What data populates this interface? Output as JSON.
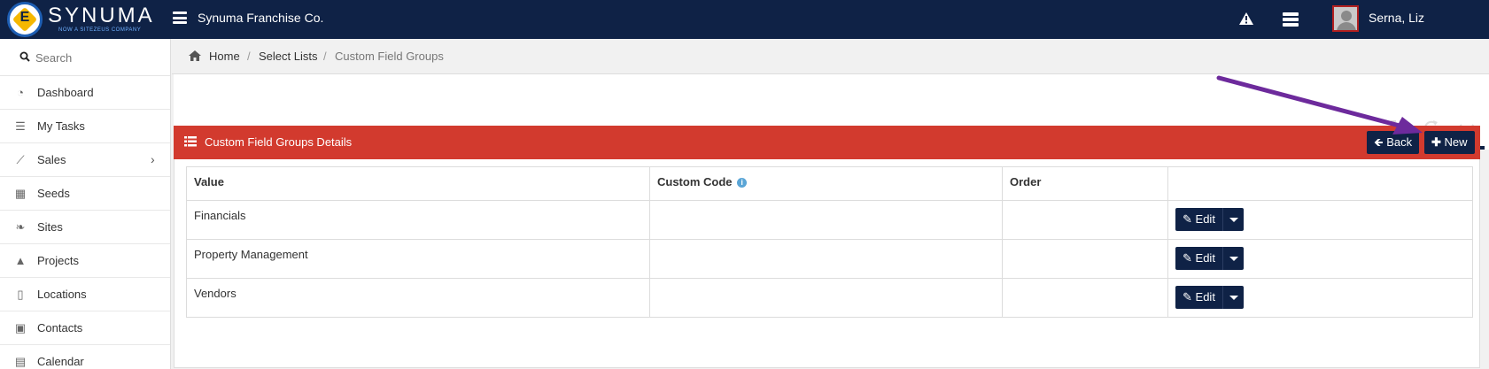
{
  "app": {
    "logo_text": "SYNUMA",
    "logo_subtext": "NOW A SITEZEUS COMPANY",
    "company": "Synuma Franchise Co.",
    "user_name": "Serna, Liz",
    "colors": {
      "topbar": "#0f2246",
      "panel_header": "#d23a2e",
      "button_dark": "#0f2246"
    }
  },
  "sidebar": {
    "search_placeholder": "Search",
    "items": [
      {
        "label": "Dashboard",
        "icon": "dashboard-icon"
      },
      {
        "label": "My Tasks",
        "icon": "list-icon"
      },
      {
        "label": "Sales",
        "icon": "chart-line-icon",
        "has_children": true
      },
      {
        "label": "Seeds",
        "icon": "grid-icon"
      },
      {
        "label": "Sites",
        "icon": "leaf-icon"
      },
      {
        "label": "Projects",
        "icon": "road-icon"
      },
      {
        "label": "Locations",
        "icon": "building-icon"
      },
      {
        "label": "Contacts",
        "icon": "contact-card-icon"
      },
      {
        "label": "Calendar",
        "icon": "calendar-icon"
      }
    ]
  },
  "breadcrumb": {
    "home": "Home",
    "level1": "Select Lists",
    "current": "Custom Field Groups",
    "separator": "/"
  },
  "panel": {
    "title": "Custom Field Groups Details",
    "back_label": "Back",
    "new_label": "New"
  },
  "table": {
    "columns": [
      "Value",
      "Custom Code",
      "Order",
      ""
    ],
    "rows": [
      {
        "value": "Financials",
        "custom_code": "",
        "order": "",
        "action_label": "Edit"
      },
      {
        "value": "Property Management",
        "custom_code": "",
        "order": "",
        "action_label": "Edit"
      },
      {
        "value": "Vendors",
        "custom_code": "",
        "order": "",
        "action_label": "Edit"
      }
    ]
  }
}
